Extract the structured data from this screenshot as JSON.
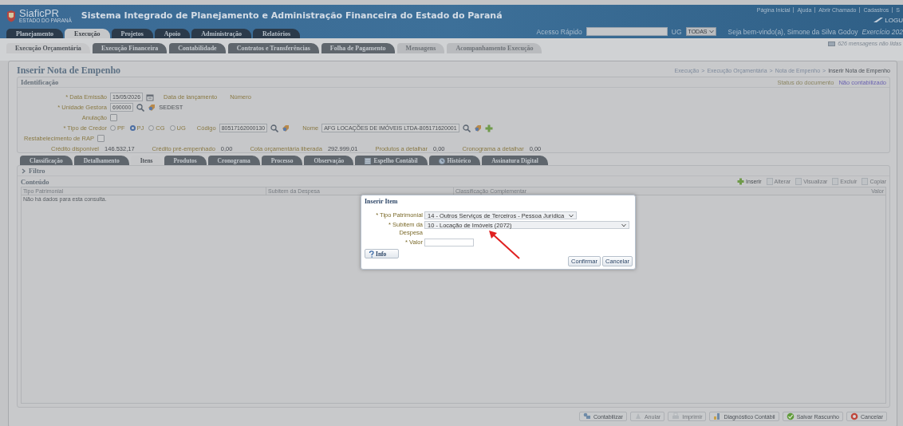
{
  "header": {
    "logo_title": "SiaficPR",
    "logo_subtitle": "ESTADO DO PARANÁ",
    "title": "Sistema Integrado de Planejamento e Administração Financeira do Estado do Paraná",
    "links": [
      "Página Inicial",
      "Ajuda",
      "Abrir Chamado",
      "Cadastros",
      "S"
    ],
    "brand": "LOGU",
    "quick_access": {
      "label": "Acesso Rápido"
    },
    "ug": {
      "label": "UG",
      "value": "TODAS"
    },
    "welcome": "Seja bem-vindo(a), Simone da Silva Godoy",
    "exercise": "Exercício 202",
    "messages": "626 mensagens não lidas"
  },
  "main_tabs": [
    {
      "label": "Planejamento",
      "selected": false
    },
    {
      "label": "Execução",
      "selected": true
    },
    {
      "label": "Projetos",
      "selected": false
    },
    {
      "label": "Apoio",
      "selected": false
    },
    {
      "label": "Administração",
      "selected": false
    },
    {
      "label": "Relatórios",
      "selected": false
    }
  ],
  "sub_tabs": [
    {
      "label": "Execução Orçamentária",
      "selected": true,
      "disabled": false
    },
    {
      "label": "Execução Financeira",
      "selected": false,
      "disabled": false
    },
    {
      "label": "Contabilidade",
      "selected": false,
      "disabled": false
    },
    {
      "label": "Contratos e Transferências",
      "selected": false,
      "disabled": false
    },
    {
      "label": "Folha de Pagamento",
      "selected": false,
      "disabled": false
    },
    {
      "label": "Mensagens",
      "selected": false,
      "disabled": true
    },
    {
      "label": "Acompanhamento Execução",
      "selected": false,
      "disabled": true
    }
  ],
  "page": {
    "title": "Inserir Nota de Empenho",
    "breadcrumb": {
      "separator": ">",
      "items": [
        "Execução",
        "Execução Orçamentária",
        "Nota de Empenho",
        "Inserir Nota de Empenho"
      ]
    }
  },
  "identification": {
    "title": "Identificação",
    "status_label": "Status do documento",
    "status_value": "Não contabilizado",
    "data_emissao": {
      "label": "* Data Emissão",
      "value": "15/05/2026"
    },
    "data_lancamento_label": "Data de lançamento",
    "numero_label": "Número",
    "unidade_gestora": {
      "label": "* Unidade Gestora",
      "value": "690000",
      "name": "SEDEST"
    },
    "anulacao": {
      "label": "Anulação",
      "checked": false
    },
    "tipo_credor": {
      "label": "* Tipo de Credor",
      "options": [
        {
          "label": "PF",
          "selected": false
        },
        {
          "label": "PJ",
          "selected": true
        },
        {
          "label": "CG",
          "selected": false
        },
        {
          "label": "UG",
          "selected": false
        }
      ]
    },
    "codigo": {
      "label": "Código",
      "value": "80517162000130"
    },
    "nome": {
      "label": "Nome",
      "value": "AFG LOCAÇÕES DE IMÓVEIS LTDA-805171620001"
    },
    "restabelecimento": {
      "label": "Restabelecimento de RAP",
      "checked": false
    },
    "summary": [
      {
        "label": "Crédito disponível",
        "value": "146.532,17"
      },
      {
        "label": "Crédito pré-empenhado",
        "value": "0,00"
      },
      {
        "label": "Cota orçamentária liberada",
        "value": "292.999,01"
      },
      {
        "label": "Produtos a detalhar",
        "value": "0,00"
      },
      {
        "label": "Cronograma a detalhar",
        "value": "0,00"
      }
    ]
  },
  "doc_tabs": [
    {
      "label": "Classificação",
      "selected": false,
      "kind": "plain"
    },
    {
      "label": "Detalhamento",
      "selected": false,
      "kind": "plain"
    },
    {
      "label": "Itens",
      "selected": true,
      "kind": "plain"
    },
    {
      "label": "Produtos",
      "selected": false,
      "kind": "plain"
    },
    {
      "label": "Cronograma",
      "selected": false,
      "kind": "plain"
    },
    {
      "label": "Processo",
      "selected": false,
      "kind": "plain"
    },
    {
      "label": "Observação",
      "selected": false,
      "kind": "plain"
    },
    {
      "label": "Espelho Contábil",
      "selected": false,
      "kind": "sheet"
    },
    {
      "label": "Histórico",
      "selected": false,
      "kind": "history"
    },
    {
      "label": "Assinatura Digital",
      "selected": false,
      "kind": "plain"
    }
  ],
  "filter": {
    "label": "Filtro",
    "expanded": false
  },
  "content": {
    "title": "Conteúdo",
    "toolbar": [
      {
        "label": "Inserir",
        "disabled": false
      },
      {
        "label": "Alterar",
        "disabled": true
      },
      {
        "label": "Visualizar",
        "disabled": true
      },
      {
        "label": "Excluir",
        "disabled": true
      },
      {
        "label": "Copiar",
        "disabled": true
      }
    ],
    "columns": [
      "Tipo Patrimonial",
      "Subitem da Despesa",
      "Classificação Complementar",
      "Valor"
    ],
    "empty_message": "Não há dados para esta consulta."
  },
  "actions": [
    {
      "label": "Contabilizar",
      "disabled": false
    },
    {
      "label": "Anular",
      "disabled": true
    },
    {
      "label": "Imprimir",
      "disabled": true
    },
    {
      "label": "Diagnóstico Contábil",
      "disabled": false
    },
    {
      "label": "Salvar Rascunho",
      "disabled": false
    },
    {
      "label": "Cancelar",
      "disabled": false
    }
  ],
  "dialog": {
    "title": "Inserir Item",
    "tipo_patrimonial": {
      "label": "* Tipo Patrimonial",
      "value": "14 - Outros Serviços de Terceiros - Pessoa Jurídica"
    },
    "subitem": {
      "label": "* Subitem da Despesa",
      "value": "10 - Locação de Imóveis (2072)"
    },
    "valor": {
      "label": "* Valor"
    },
    "info_button": "Info",
    "confirm_button": "Confirmar",
    "cancel_button": "Cancelar"
  }
}
